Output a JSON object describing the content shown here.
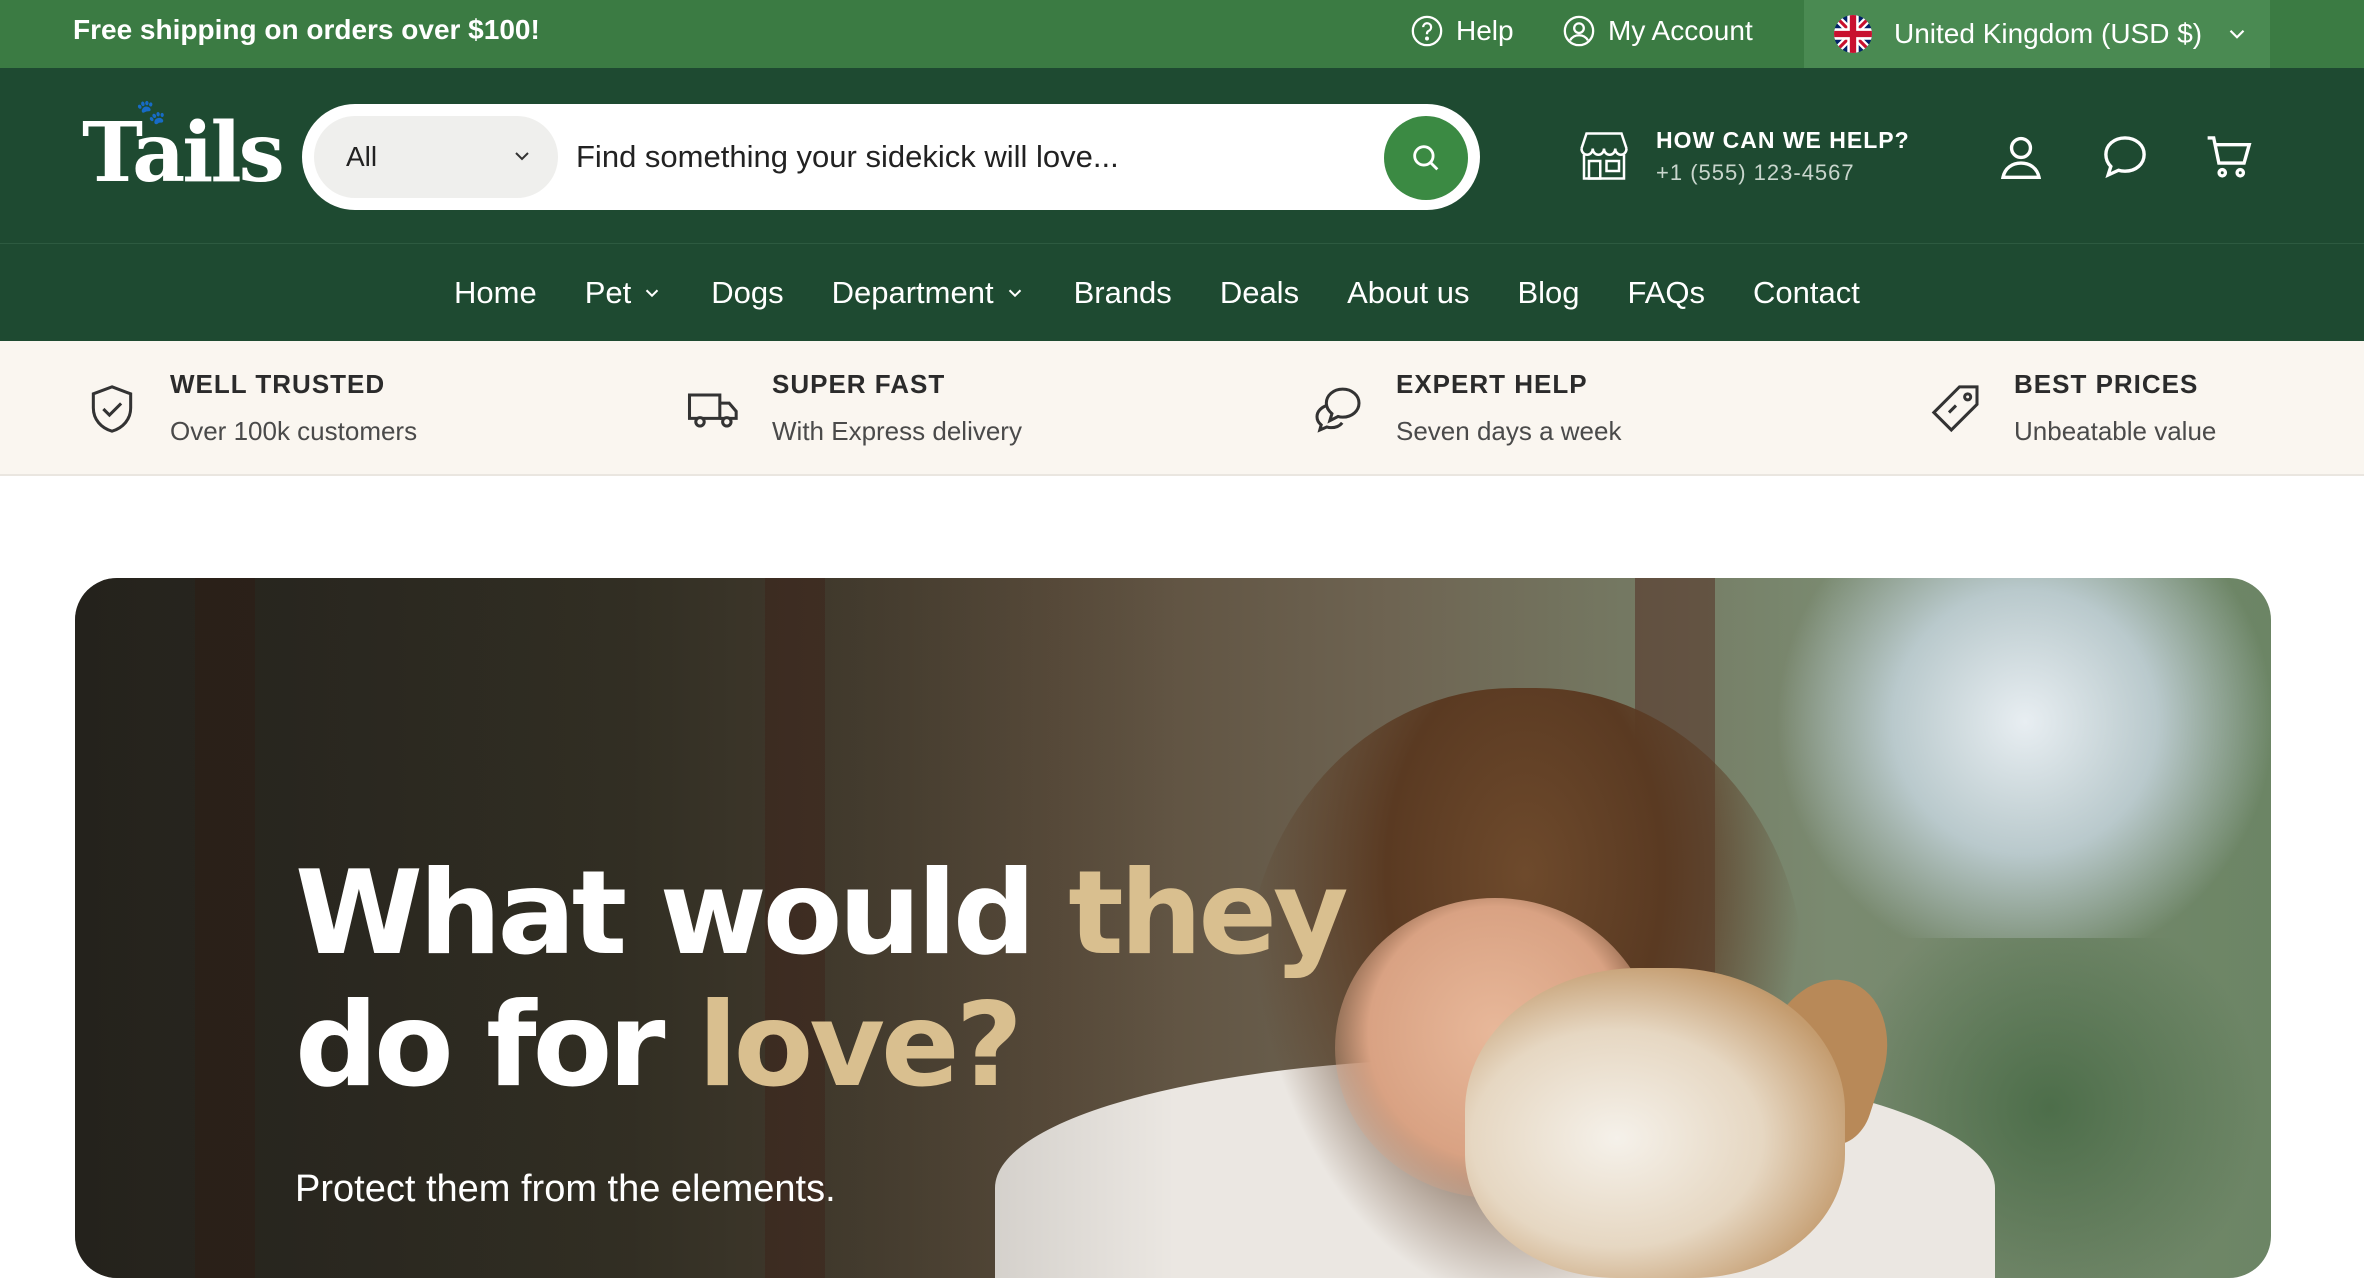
{
  "topbar": {
    "promo": "Free shipping on orders over $100!",
    "help_label": "Help",
    "account_label": "My Account",
    "region_label": "United Kingdom (USD $)"
  },
  "header": {
    "logo_text": "Tails",
    "search": {
      "category": "All",
      "placeholder": "Find something your sidekick will love..."
    },
    "help_title": "HOW CAN WE HELP?",
    "help_phone": "+1 (555) 123-4567"
  },
  "nav": {
    "items": [
      {
        "label": "Home",
        "dropdown": false
      },
      {
        "label": "Pet",
        "dropdown": true
      },
      {
        "label": "Dogs",
        "dropdown": false
      },
      {
        "label": "Department",
        "dropdown": true
      },
      {
        "label": "Brands",
        "dropdown": false
      },
      {
        "label": "Deals",
        "dropdown": false
      },
      {
        "label": "About us",
        "dropdown": false
      },
      {
        "label": "Blog",
        "dropdown": false
      },
      {
        "label": "FAQs",
        "dropdown": false
      },
      {
        "label": "Contact",
        "dropdown": false
      }
    ]
  },
  "features": [
    {
      "icon": "shield-check-icon",
      "title": "WELL TRUSTED",
      "subtitle": "Over 100k customers"
    },
    {
      "icon": "truck-icon",
      "title": "SUPER FAST",
      "subtitle": "With Express delivery"
    },
    {
      "icon": "chat-bubbles-icon",
      "title": "EXPERT HELP",
      "subtitle": "Seven days a week"
    },
    {
      "icon": "price-tag-icon",
      "title": "BEST PRICES",
      "subtitle": "Unbeatable value"
    }
  ],
  "hero": {
    "line1_a": "What would ",
    "line1_b": "they",
    "line2_a": "do for ",
    "line2_b": "love?",
    "subtitle": "Protect them from the elements."
  },
  "colors": {
    "topbar_green": "#3b7b43",
    "header_green": "#1e4a31",
    "accent_green": "#3b8a43",
    "gold": "#d9bf8f",
    "feature_bg": "#faf6f0"
  }
}
